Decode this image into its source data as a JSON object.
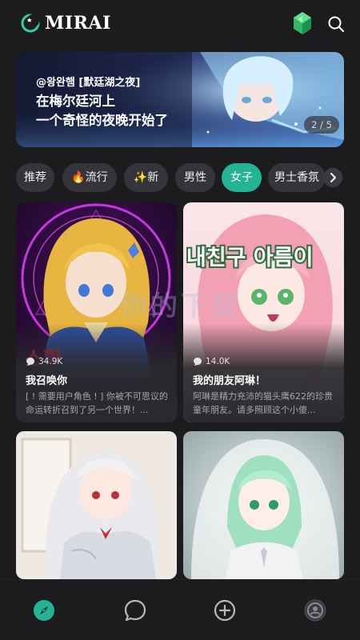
{
  "app": {
    "name": "MIRAI"
  },
  "icons": {
    "logo": "logo-icon",
    "gem": "gem-icon",
    "search": "search-icon",
    "chevron": "chevron-right-icon",
    "chat_count": "chat-bubble-icon"
  },
  "banner": {
    "author": "@왕완햄 [默廷湖之夜]",
    "line1": "在梅尔廷河上",
    "line2": "一个奇怪的夜晚开始了",
    "page": "2 / 5"
  },
  "tabs": [
    {
      "label": "推荐",
      "active": false
    },
    {
      "label": "🔥流行",
      "active": false
    },
    {
      "label": "✨新",
      "active": false
    },
    {
      "label": "男性",
      "active": false
    },
    {
      "label": "女子",
      "active": true
    },
    {
      "label": "男士香氛",
      "active": false
    }
  ],
  "cards": [
    {
      "count": "34.9K",
      "title": "我召唤你",
      "desc": "[ ! 需要用户角色 ! ] 你被不可思议的命运转折召到了另一个世界！..."
    },
    {
      "count": "14.0K",
      "title": "我的朋友阿琳！",
      "desc": "阿琳是精力充沛的猫头鹰622的珍贵童年朋友。请多照顾这个小傻..."
    },
    {
      "count": "",
      "title": "",
      "desc": ""
    },
    {
      "count": "",
      "title": "",
      "desc": ""
    }
  ],
  "art_text": {
    "card2_korean": "내친구 아름이",
    "card1_hangul": "소환"
  },
  "watermark": "你的下载",
  "nav": [
    {
      "name": "explore",
      "icon": "compass-icon",
      "active": true
    },
    {
      "name": "chat",
      "icon": "chat-icon",
      "active": false
    },
    {
      "name": "create",
      "icon": "plus-circle-icon",
      "active": false
    },
    {
      "name": "profile",
      "icon": "profile-icon",
      "active": false
    }
  ],
  "colors": {
    "accent": "#23b496",
    "background": "#1c1c1e",
    "tab": "#34343a",
    "card": "#2a2a2e"
  }
}
